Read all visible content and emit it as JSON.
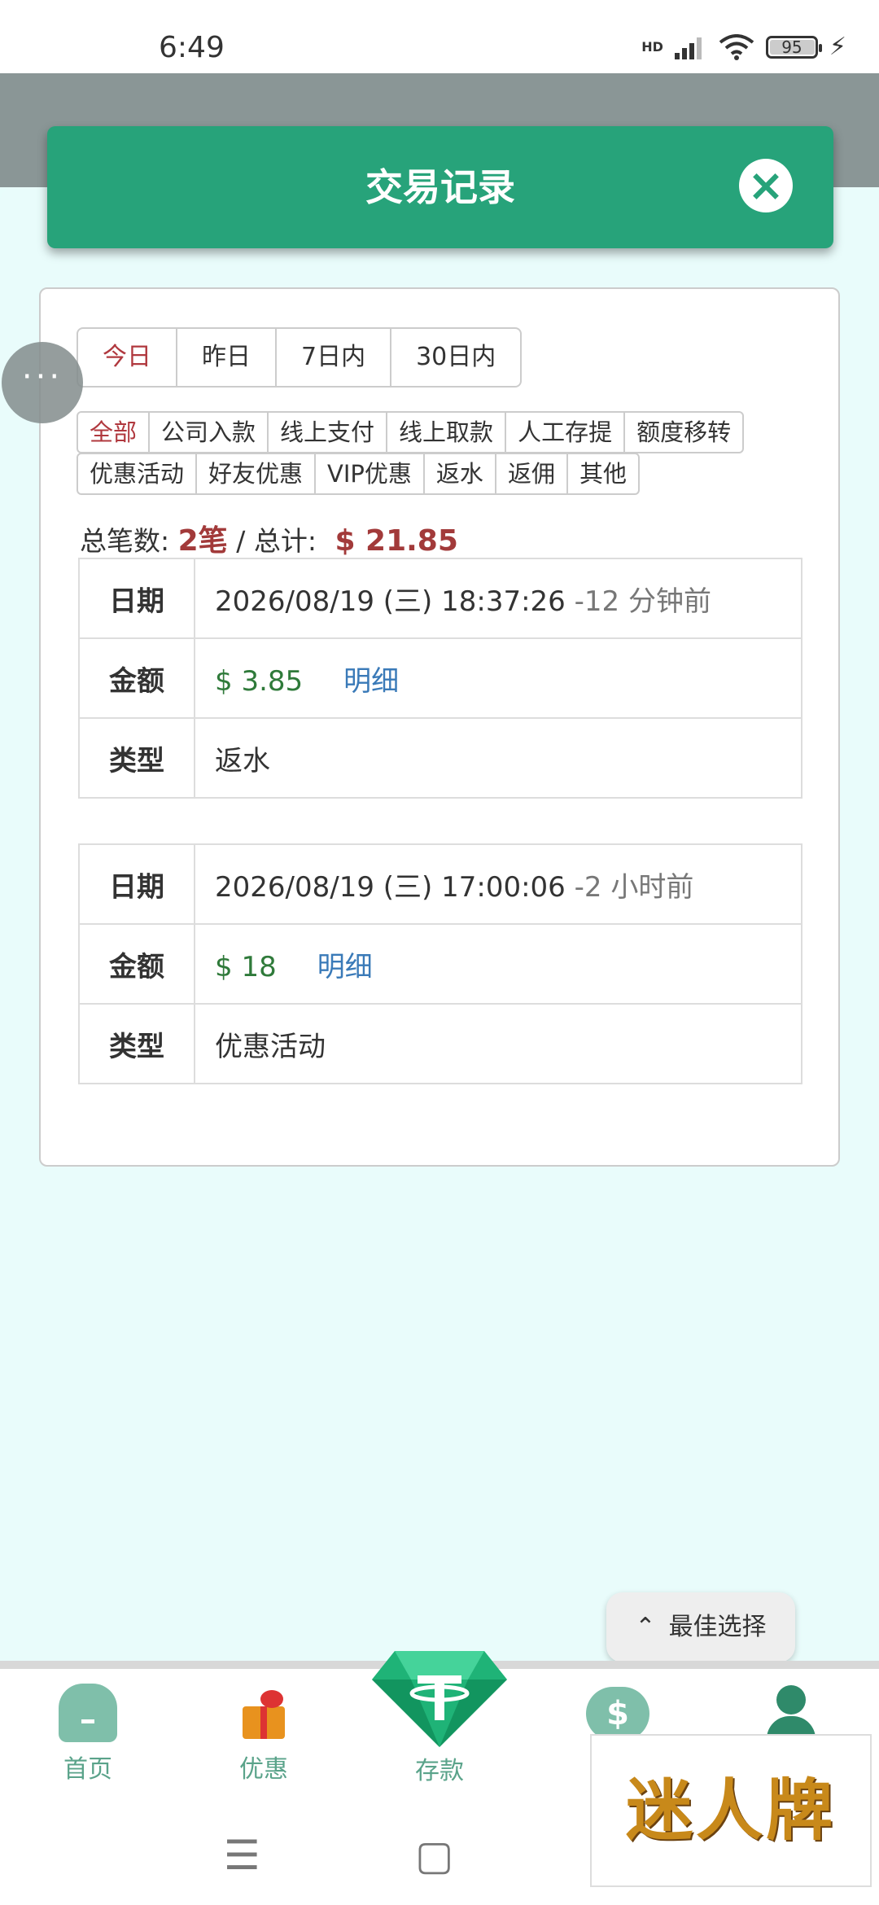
{
  "status_bar": {
    "time": "6:49",
    "network": "HD",
    "battery": "95"
  },
  "header": {
    "title": "交易记录"
  },
  "float_menu": {
    "label": "···"
  },
  "date_tabs": [
    "今日",
    "昨日",
    "7日内",
    "30日内"
  ],
  "filters": {
    "row1": [
      "全部",
      "公司入款",
      "线上支付",
      "线上取款",
      "人工存提",
      "额度移转"
    ],
    "row2": [
      "优惠活动",
      "好友优惠",
      "VIP优惠",
      "返水",
      "返佣",
      "其他"
    ]
  },
  "summary": {
    "count_label": "总笔数:",
    "count": "2笔",
    "sep": "/",
    "total_label": "总计:",
    "total": "$ 21.85"
  },
  "labels": {
    "date": "日期",
    "amount": "金额",
    "type": "类型",
    "detail": "明细"
  },
  "records": [
    {
      "date": "2026/08/19 (三) 18:37:26",
      "ago": "-12 分钟前",
      "amount": "$ 3.85",
      "type": "返水"
    },
    {
      "date": "2026/08/19 (三) 17:00:06",
      "ago": "-2 小时前",
      "amount": "$ 18",
      "type": "优惠活动"
    }
  ],
  "best_choice": {
    "icon": "≈",
    "label": "最佳选择"
  },
  "bottom_nav": {
    "home": "首页",
    "promo": "优惠",
    "deposit": "存款"
  },
  "ad": {
    "text": "迷人牌"
  },
  "system_nav": {
    "menu": "☰",
    "home": "▢"
  },
  "colors": {
    "primary": "#27a37a",
    "accent_red": "#a23a3a",
    "amount_green": "#2f7a3a",
    "link_blue": "#3a7ab8"
  }
}
